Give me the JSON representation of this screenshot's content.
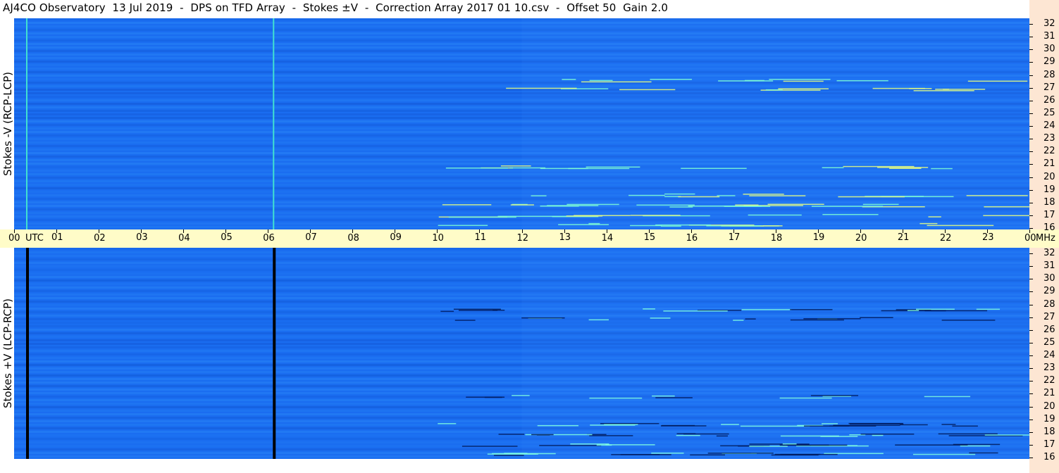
{
  "title": "AJ4CO Observatory  13 Jul 2019  -  DPS on TFD Array  -  Stokes ±V  -  Correction Array 2017 01 10.csv  -  Offset 50  Gain 2.0",
  "colors": {
    "background": "#1a6df0",
    "time_axis_bg": "#fffcc8",
    "freq_axis_bg": "#fde6d3",
    "band_dark": "#0a3fb8",
    "band_light": "#3aa0ff"
  },
  "chart_data": [
    {
      "type": "heatmap",
      "panel": "top",
      "ylabel": "Stokes -V  (RCP-LCP)",
      "x_unit_label": "UTC",
      "y_unit_label": "MHz",
      "x_ticks": [
        "00",
        "01",
        "02",
        "03",
        "04",
        "05",
        "06",
        "07",
        "08",
        "09",
        "10",
        "11",
        "12",
        "13",
        "14",
        "15",
        "16",
        "17",
        "18",
        "19",
        "20",
        "21",
        "22",
        "23",
        "00"
      ],
      "y_ticks": [
        "32",
        "31",
        "30",
        "29",
        "28",
        "27",
        "26",
        "25",
        "24",
        "23",
        "22",
        "21",
        "20",
        "19",
        "18",
        "17",
        "16"
      ],
      "xlim": [
        0,
        24
      ],
      "ylim": [
        16,
        32
      ],
      "vertical_artifacts_utc": [
        0.15,
        6.15
      ],
      "emission_bands_mhz": [
        16.3,
        17.0,
        17.8,
        18.6,
        20.8,
        26.9,
        27.6
      ]
    },
    {
      "type": "heatmap",
      "panel": "bottom",
      "ylabel": "Stokes +V  (LCP-RCP)",
      "x_unit_label": "UTC",
      "y_unit_label": "MHz",
      "x_ticks": [
        "00",
        "01",
        "02",
        "03",
        "04",
        "05",
        "06",
        "07",
        "08",
        "09",
        "10",
        "11",
        "12",
        "13",
        "14",
        "15",
        "16",
        "17",
        "18",
        "19",
        "20",
        "21",
        "22",
        "23",
        "00"
      ],
      "y_ticks": [
        "32",
        "31",
        "30",
        "29",
        "28",
        "27",
        "26",
        "25",
        "24",
        "23",
        "22",
        "21",
        "20",
        "19",
        "18",
        "17",
        "16"
      ],
      "xlim": [
        0,
        24
      ],
      "ylim": [
        16,
        32
      ],
      "vertical_artifacts_utc": [
        0.15,
        6.15
      ],
      "emission_bands_mhz": [
        16.3,
        17.0,
        17.8,
        18.6,
        20.8,
        26.9,
        27.6
      ]
    }
  ]
}
